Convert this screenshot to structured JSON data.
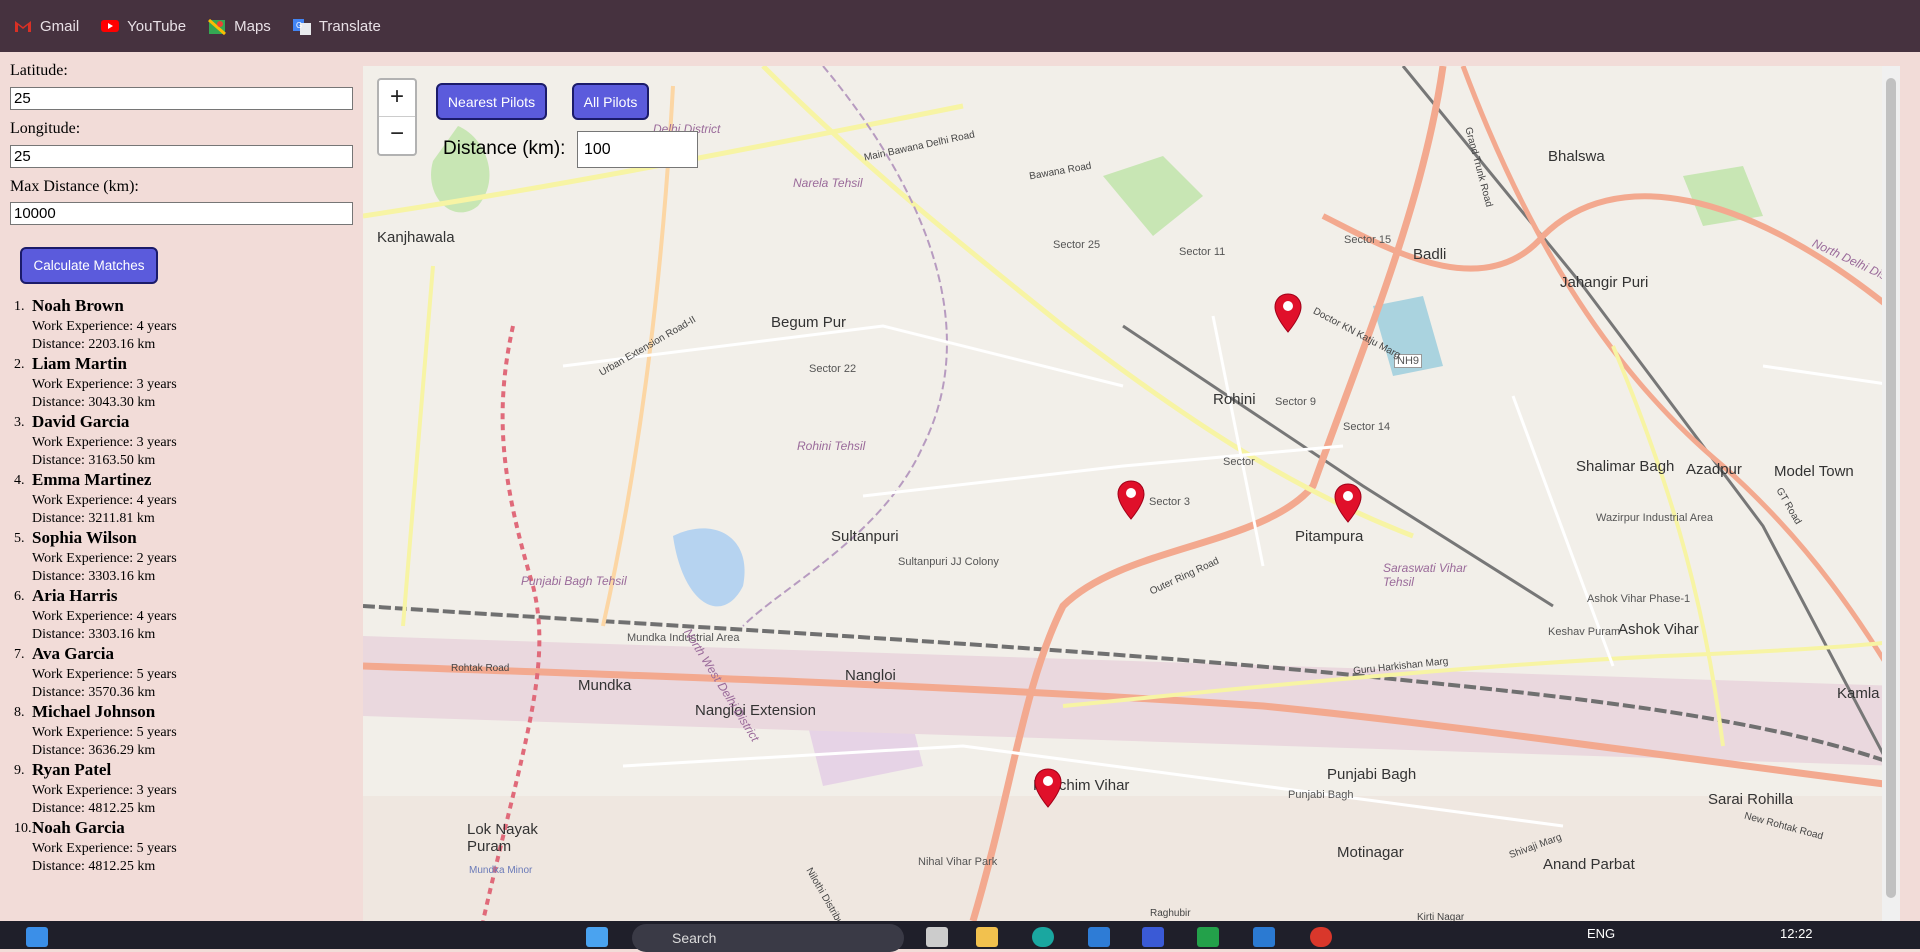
{
  "bookmarks": [
    {
      "label": "Gmail",
      "icon": "gmail-icon",
      "color": "#d93025"
    },
    {
      "label": "YouTube",
      "icon": "youtube-icon",
      "color": "#ff0000"
    },
    {
      "label": "Maps",
      "icon": "maps-icon",
      "color": "#34a853"
    },
    {
      "label": "Translate",
      "icon": "translate-icon",
      "color": "#4285f4"
    }
  ],
  "form": {
    "latitude_label": "Latitude:",
    "latitude_value": "25",
    "longitude_label": "Longitude:",
    "longitude_value": "25",
    "max_distance_label": "Max Distance (km):",
    "max_distance_value": "10000",
    "calculate_button": "Calculate Matches"
  },
  "results": [
    {
      "num": "1.",
      "name": "Noah Brown",
      "experience": "Work Experience: 4 years",
      "distance": "Distance: 2203.16 km"
    },
    {
      "num": "2.",
      "name": "Liam Martin",
      "experience": "Work Experience: 3 years",
      "distance": "Distance: 3043.30 km"
    },
    {
      "num": "3.",
      "name": "David Garcia",
      "experience": "Work Experience: 3 years",
      "distance": "Distance: 3163.50 km"
    },
    {
      "num": "4.",
      "name": "Emma Martinez",
      "experience": "Work Experience: 4 years",
      "distance": "Distance: 3211.81 km"
    },
    {
      "num": "5.",
      "name": "Sophia Wilson",
      "experience": "Work Experience: 2 years",
      "distance": "Distance: 3303.16 km"
    },
    {
      "num": "6.",
      "name": "Aria Harris",
      "experience": "Work Experience: 4 years",
      "distance": "Distance: 3303.16 km"
    },
    {
      "num": "7.",
      "name": "Ava Garcia",
      "experience": "Work Experience: 5 years",
      "distance": "Distance: 3570.36 km"
    },
    {
      "num": "8.",
      "name": "Michael Johnson",
      "experience": "Work Experience: 5 years",
      "distance": "Distance: 3636.29 km"
    },
    {
      "num": "9.",
      "name": "Ryan Patel",
      "experience": "Work Experience: 3 years",
      "distance": "Distance: 4812.25 km"
    },
    {
      "num": "10.",
      "name": "Noah Garcia",
      "experience": "Work Experience: 5 years",
      "distance": "Distance: 4812.25 km"
    }
  ],
  "map": {
    "zoom_in": "+",
    "zoom_out": "−",
    "nearest_button": "Nearest Pilots",
    "all_button": "All Pilots",
    "distance_label": "Distance (km):",
    "distance_value": "100",
    "marker_color": "#e0102a",
    "places_big": [
      "Kanjhawala",
      "Begum Pur",
      "Bhalswa",
      "Badli",
      "Jahangir Puri",
      "Rohini",
      "Shalimar Bagh",
      "Azadpur",
      "Model Town",
      "Pitampura",
      "Sultanpuri",
      "Mundka",
      "Nangloi",
      "Nangloi Extension",
      "Ashok Vihar",
      "Kamla Nag",
      "Paschim Vihar",
      "Punjabi Bagh",
      "Sarai Rohilla",
      "Lok Nayak Puram",
      "Motinagar",
      "Anand Parbat"
    ],
    "places_small": [
      "Sector 25",
      "Sector 11",
      "Sector 15",
      "Sector 22",
      "Sector 9",
      "Sector 14",
      "Sector",
      "Sector 3",
      "Sultanpuri JJ Colony",
      "Mundka Industrial Area",
      "Keshav Puram",
      "Ashok Vihar Phase-1",
      "Wazirpur Industrial Area",
      "Nihal Vihar Park",
      "Punjabi Bagh",
      "NH9"
    ],
    "places_purple": [
      "Narela Tehsil",
      "Rohini Tehsil",
      "Punjabi Bagh Tehsil",
      "North West Delhi District",
      "Saraswati Vihar Tehsil",
      "Delhi District",
      "North Delhi District"
    ],
    "roads": [
      "Main Bawana Delhi Road",
      "Bawana Road",
      "Urban Extension Road-II",
      "Doctor KN Katju Marg",
      "Outer Ring Road",
      "Rohtak Road",
      "Guru Harkishan Marg",
      "Grand Trunk Road",
      "GT Road",
      "New Rohtak Road",
      "Shivaji Marg",
      "Nilothi Distributary",
      "Mundka Minor",
      "Raghubir",
      "Kirti Nagar"
    ]
  },
  "taskbar": {
    "search_placeholder": "Search",
    "language": "ENG",
    "time": "12:22"
  }
}
